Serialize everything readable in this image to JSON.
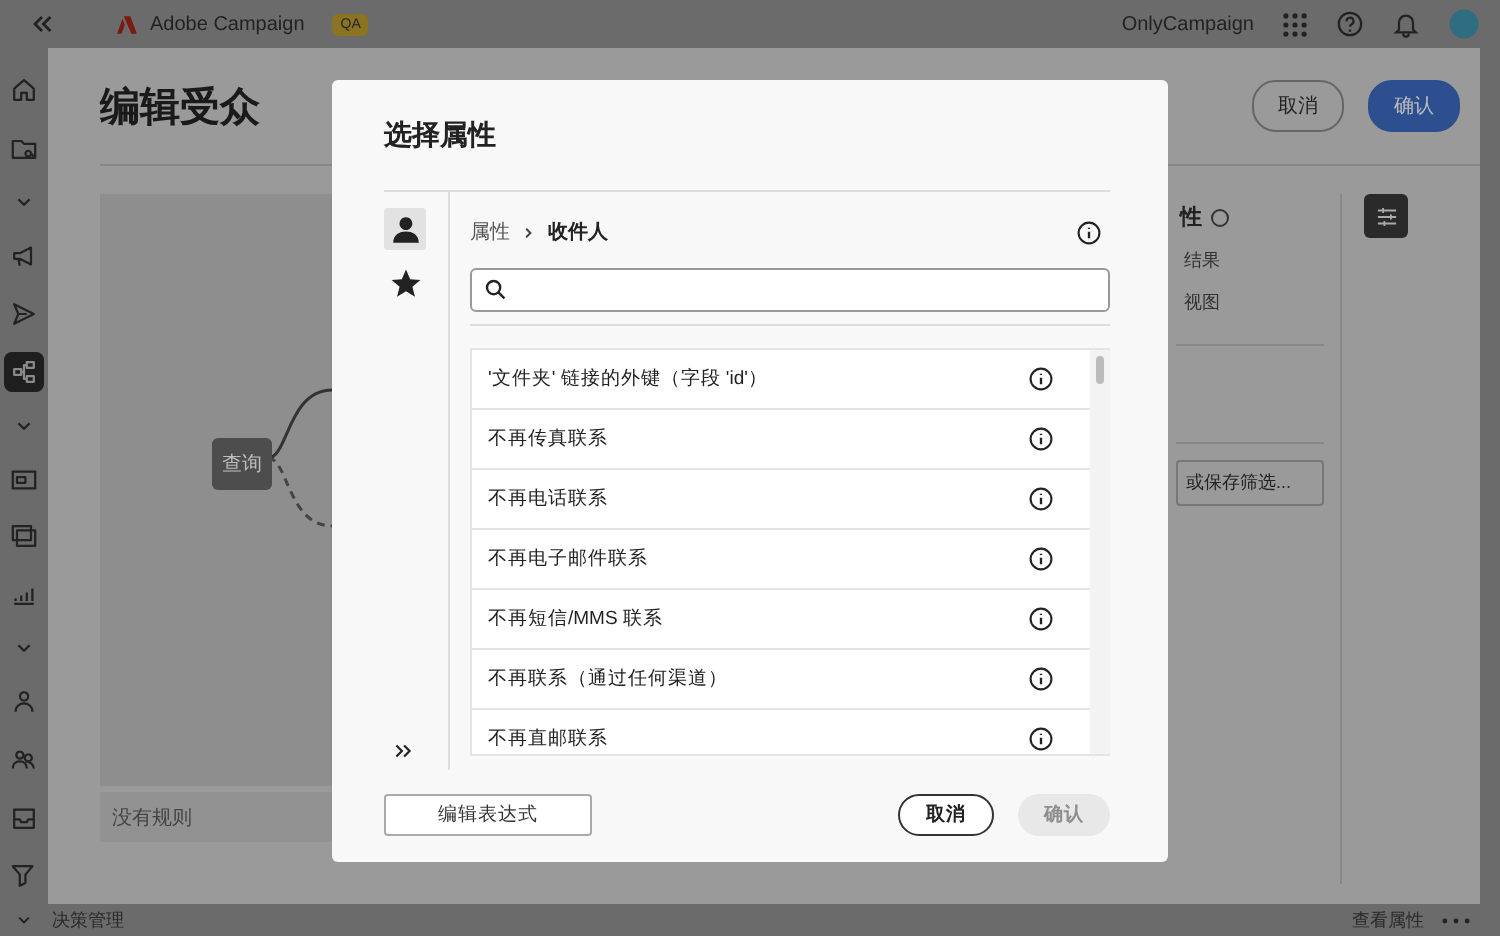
{
  "app": {
    "title": "Adobe Campaign",
    "env_badge": "QA",
    "org": "OnlyCampaign"
  },
  "sidebar": {
    "items": [
      {
        "kind": "home",
        "selected": false
      },
      {
        "kind": "folder",
        "selected": false
      },
      {
        "kind": "chevron",
        "selected": false
      },
      {
        "kind": "megaphone",
        "selected": false
      },
      {
        "kind": "send",
        "selected": false
      },
      {
        "kind": "workflow",
        "selected": true
      },
      {
        "kind": "chevron",
        "selected": false
      },
      {
        "kind": "card",
        "selected": false
      },
      {
        "kind": "window",
        "selected": false
      },
      {
        "kind": "chart",
        "selected": false
      },
      {
        "kind": "chevron",
        "selected": false
      },
      {
        "kind": "person",
        "selected": false
      },
      {
        "kind": "people",
        "selected": false
      },
      {
        "kind": "inbox",
        "selected": false
      },
      {
        "kind": "filter",
        "selected": false
      }
    ]
  },
  "page": {
    "title": "编辑受众",
    "buttons": [
      {
        "label": "取消",
        "kind": "secondary"
      },
      {
        "label": "确认",
        "kind": "primary"
      }
    ],
    "canvas": {
      "node": "查询"
    },
    "rules_bar": "没有规则",
    "side_panel": {
      "heading": "性",
      "rows": [
        "结果",
        "视图"
      ],
      "button": "或保存筛选..."
    }
  },
  "bottom_bar": {
    "section": "决策管理",
    "link": "查看属性"
  },
  "dialog": {
    "title": "选择属性",
    "tabs": [
      {
        "kind": "person",
        "selected": true
      },
      {
        "kind": "star",
        "selected": false
      }
    ],
    "breadcrumb": [
      "属性",
      "收件人"
    ],
    "rows": [
      "'文件夹' 链接的外键（字段 'id'）",
      "不再传真联系",
      "不再电话联系",
      "不再电子邮件联系",
      "不再短信/MMS 联系",
      "不再联系（通过任何渠道）",
      "不再直邮联系"
    ],
    "buttons": [
      {
        "label": "编辑表达式",
        "kind": "secondary",
        "disabled": false
      },
      {
        "label": "取消",
        "kind": "outline",
        "disabled": false
      },
      {
        "label": "确认",
        "kind": "primary",
        "disabled": true
      }
    ]
  }
}
